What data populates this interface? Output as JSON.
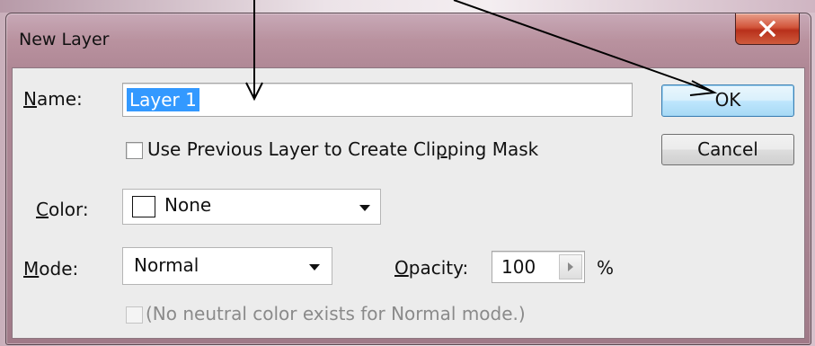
{
  "dialog": {
    "title": "New Layer",
    "close_glyph": "X"
  },
  "form": {
    "name_label_u": "N",
    "name_label_rest": "ame:",
    "name_value": "Layer 1",
    "clipping_mask_label_pre": "Use Previous Layer to Create Cli",
    "clipping_mask_label_u": "p",
    "clipping_mask_label_post": "ping Mask",
    "clipping_mask_checked": false,
    "color_label_u": "C",
    "color_label_rest": "olor:",
    "color_value": "None",
    "mode_label_u": "M",
    "mode_label_rest": "ode:",
    "mode_value": "Normal",
    "opacity_label_u": "O",
    "opacity_label_rest": "pacity:",
    "opacity_value": "100",
    "opacity_unit": "%",
    "neutral_color_label": "(No neutral color exists for Normal mode.)",
    "neutral_color_checked": false
  },
  "buttons": {
    "ok": "OK",
    "cancel": "Cancel"
  },
  "icons": {
    "close": "close-icon",
    "color_swatch": "swatch-icon",
    "dropdown": "chevron-down-icon",
    "spinner": "triangle-right-icon"
  },
  "colors": {
    "selection": "#3399ff",
    "close_button": "#c8432a",
    "default_button": "#bee6fd"
  }
}
